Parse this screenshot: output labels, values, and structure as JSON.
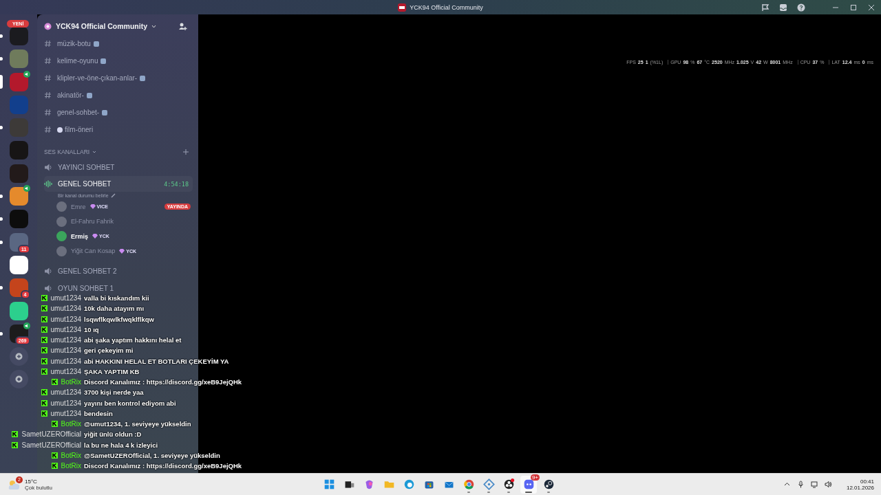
{
  "window": {
    "title": "YCK94 Official Community"
  },
  "overlay_stats": [
    {
      "label": "FPS",
      "values": [
        {
          "value": "25"
        },
        {
          "value": "1",
          "unit": "(%1L)"
        }
      ]
    },
    {
      "label": "GPU",
      "values": [
        {
          "value": "98",
          "unit": "%"
        },
        {
          "value": "67",
          "unit": "°C"
        },
        {
          "value": "2520",
          "unit": "MHz"
        },
        {
          "value": "1.025",
          "unit": "V"
        },
        {
          "value": "42",
          "unit": "W"
        },
        {
          "value": "8001",
          "unit": "MHz"
        }
      ]
    },
    {
      "label": "CPU",
      "values": [
        {
          "value": "37",
          "unit": "%"
        }
      ]
    },
    {
      "label": "LAT",
      "values": [
        {
          "value": "12.4",
          "unit": "ms"
        },
        {
          "value": "0",
          "unit": "ms"
        }
      ]
    }
  ],
  "server_rail": {
    "new_badge": "YENİ",
    "servers": [
      {
        "color": "#1b1b1f",
        "selected": false,
        "unread": true,
        "voice": false
      },
      {
        "color": "#6f7b5c",
        "selected": false,
        "unread": true,
        "voice": false
      },
      {
        "color": "#b3192c",
        "selected": true,
        "unread": false,
        "voice": true
      },
      {
        "color": "#123f8c",
        "selected": false,
        "unread": false,
        "voice": false
      },
      {
        "color": "#3d3a38",
        "selected": false,
        "unread": true,
        "voice": false
      },
      {
        "color": "#171515",
        "selected": false,
        "unread": false,
        "voice": false
      },
      {
        "color": "#221a1a",
        "selected": false,
        "unread": false,
        "voice": false
      },
      {
        "color": "#e58a2c",
        "selected": false,
        "unread": true,
        "voice": true
      },
      {
        "color": "#0d0d0d",
        "selected": false,
        "unread": true,
        "voice": false
      },
      {
        "color": "#5a6782",
        "selected": false,
        "unread": true,
        "voice": false,
        "badge": "11"
      },
      {
        "color": "#ffffff",
        "selected": false,
        "unread": false,
        "voice": false
      },
      {
        "color": "#c4441c",
        "selected": false,
        "unread": true,
        "voice": false,
        "badge": "4"
      },
      {
        "color": "#2ccf8d",
        "selected": false,
        "unread": false,
        "voice": false
      },
      {
        "color": "#1c1c1c",
        "selected": false,
        "unread": true,
        "voice": true,
        "badge": "269"
      }
    ]
  },
  "channel_panel": {
    "server_name": "YCK94 Official Community",
    "text_channels": [
      {
        "name": "müzik-botu",
        "kind": "trailing-emoji"
      },
      {
        "name": "kelime-oyunu",
        "kind": "trailing-emoji"
      },
      {
        "name": "klipler-ve-öne-çıkan-anlar-",
        "kind": "trailing-emoji"
      },
      {
        "name": "akinatör-",
        "kind": "trailing-emoji"
      },
      {
        "name": "genel-sohbet-",
        "kind": "trailing-emoji"
      },
      {
        "name": "film-öneri",
        "kind": "leading-emoji"
      }
    ],
    "voice_category": "SES KANALLARI",
    "voice_channels": [
      {
        "name": "YAYINCI SOHBET",
        "active": false
      },
      {
        "name": "GENEL SOHBET",
        "active": true,
        "timer": "4:54:18",
        "status": "Bir kanal durumu belirle",
        "members": [
          {
            "name": "Emre",
            "tag": "VICE",
            "speaking": false,
            "live": "YAYINDA"
          },
          {
            "name": "El-Fahru Fahrik",
            "speaking": false
          },
          {
            "name": "Ermiş",
            "tag": "YCK",
            "speaking": true
          },
          {
            "name": "Yiğit Can Kosap",
            "tag": "YCK",
            "speaking": false
          }
        ]
      },
      {
        "name": "GENEL SOHBET 2",
        "active": false
      },
      {
        "name": "OYUN SOHBET 1",
        "active": false
      }
    ]
  },
  "chat_overlay": [
    {
      "user": "umut1234",
      "color": "#dcdcdc",
      "message": "valla bi kıskandım kii"
    },
    {
      "user": "umut1234",
      "color": "#dcdcdc",
      "message": "10k daha atayım mı"
    },
    {
      "user": "umut1234",
      "color": "#dcdcdc",
      "message": "lsqwflkqwlkfwqklflkqw"
    },
    {
      "user": "umut1234",
      "color": "#dcdcdc",
      "message": "10 ıq"
    },
    {
      "user": "umut1234",
      "color": "#dcdcdc",
      "message": "abi şaka yaptım hakkını helal et"
    },
    {
      "user": "umut1234",
      "color": "#dcdcdc",
      "message": "geri çekeyim mi"
    },
    {
      "user": "umut1234",
      "color": "#dcdcdc",
      "message": "abi HAKKINI HELAL ET BOTLARI ÇEKEYİM YA"
    },
    {
      "user": "umut1234",
      "color": "#dcdcdc",
      "message": "ŞAKA YAPTIM KB"
    },
    {
      "user": "BotRix",
      "color": "#53fc18",
      "message": "Discord Kanalımız : https://discord.gg/xeB9JejQHk"
    },
    {
      "user": "umut1234",
      "color": "#dcdcdc",
      "message": "3700 kişi nerde yaa"
    },
    {
      "user": "umut1234",
      "color": "#dcdcdc",
      "message": "yayını ben kontrol ediyom abi"
    },
    {
      "user": "umut1234",
      "color": "#dcdcdc",
      "message": "bendesin"
    },
    {
      "user": "BotRix",
      "color": "#53fc18",
      "message": "@umut1234, 1. seviyeye yükseldin"
    },
    {
      "user": "SametUZEROfficial",
      "color": "#dcdcdc",
      "message": "yiğit ünlü oldun :D"
    },
    {
      "user": "SametUZEROfficial",
      "color": "#dcdcdc",
      "message": "la bu ne hala 4 k izleyici"
    },
    {
      "user": "BotRix",
      "color": "#53fc18",
      "message": "@SametUZEROfficial, 1. seviyeye yükseldin"
    },
    {
      "user": "BotRix",
      "color": "#53fc18",
      "message": "Discord Kanalımız : https://discord.gg/xeB9JejQHk"
    }
  ],
  "taskbar": {
    "weather": {
      "temperature": "15°C",
      "condition": "Çok bulutlu",
      "badge": "2"
    },
    "apps": [
      {
        "kind": "start",
        "running": false,
        "selected": false
      },
      {
        "kind": "taskview",
        "running": false,
        "selected": false
      },
      {
        "kind": "copilot",
        "running": false,
        "selected": false
      },
      {
        "kind": "folder",
        "running": false,
        "selected": false
      },
      {
        "kind": "edge",
        "running": false,
        "selected": false
      },
      {
        "kind": "store",
        "running": false,
        "selected": false
      },
      {
        "kind": "mail",
        "running": false,
        "selected": false
      },
      {
        "kind": "chrome",
        "running": true,
        "selected": false
      },
      {
        "kind": "network",
        "running": true,
        "selected": false
      },
      {
        "kind": "obs",
        "running": true,
        "selected": false
      },
      {
        "kind": "discord",
        "running": true,
        "selected": true,
        "badge": "9+"
      },
      {
        "kind": "steam",
        "running": true,
        "selected": false
      }
    ],
    "clock": {
      "time": "00:41",
      "date": "12.01.2026"
    }
  }
}
